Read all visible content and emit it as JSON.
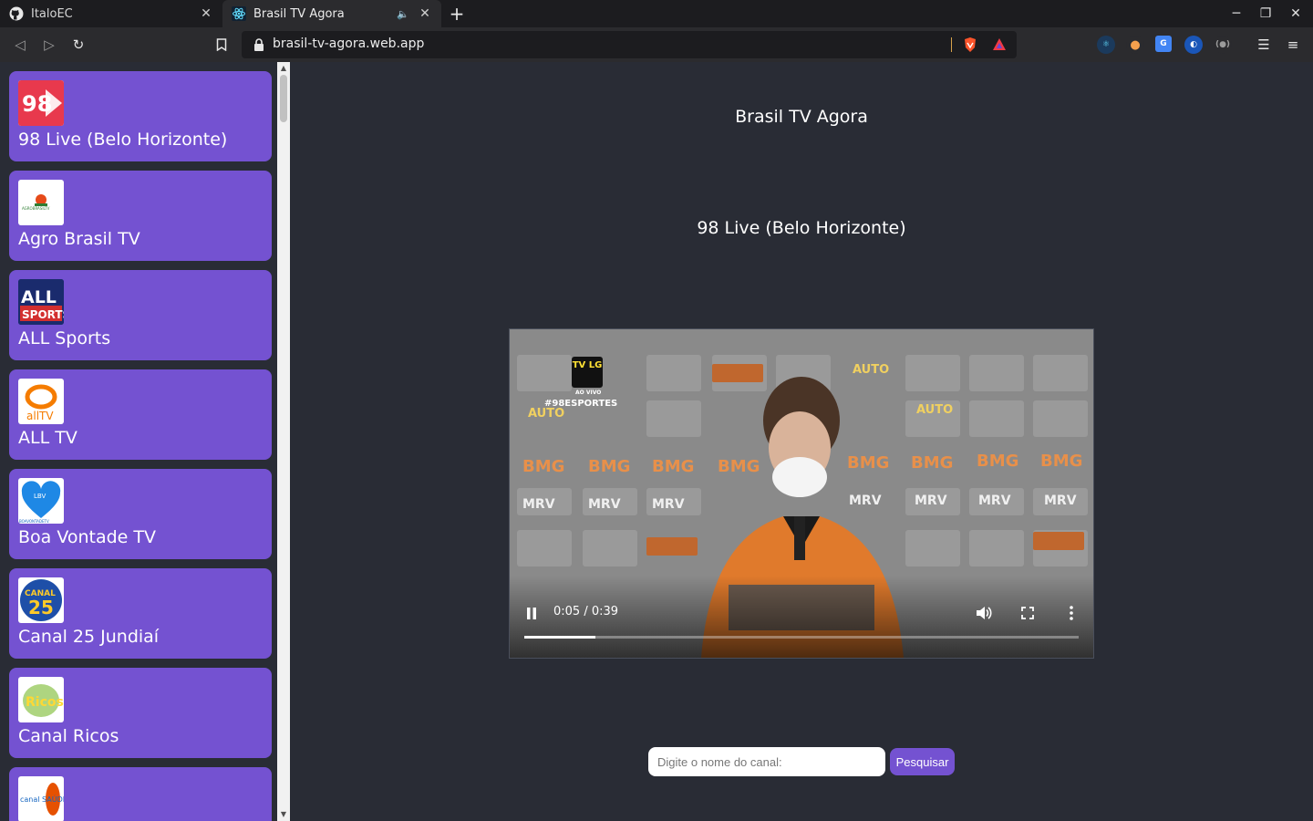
{
  "browser": {
    "tabs": [
      {
        "title": "ItaloEC",
        "active": false
      },
      {
        "title": "Brasil TV Agora",
        "active": true
      }
    ],
    "url": "brasil-tv-agora.web.app"
  },
  "app": {
    "title": "Brasil TV Agora",
    "current_channel": "98 Live (Belo Horizonte)"
  },
  "channels": [
    {
      "name": "98 Live (Belo Horizonte)",
      "logo_text": "98"
    },
    {
      "name": "Agro Brasil TV",
      "logo_text": "AGROBRASILTV"
    },
    {
      "name": "ALL Sports",
      "logo_text": "ALL SPORTS"
    },
    {
      "name": "ALL TV",
      "logo_text": "allTV"
    },
    {
      "name": "Boa Vontade TV",
      "logo_text": "BOAVONTADETV"
    },
    {
      "name": "Canal 25 Jundiaí",
      "logo_text": "CANAL 25"
    },
    {
      "name": "Canal Ricos",
      "logo_text": "Ricos"
    },
    {
      "name": "",
      "logo_text": "canal SAÚDE"
    }
  ],
  "player": {
    "time": "0:05 / 0:39",
    "progress": 0.128,
    "overlay_tag": "#98ESPORTES",
    "live_badge": "TV LG",
    "live_sub": "AO VIVO"
  },
  "search": {
    "placeholder": "Digite o nome do canal:",
    "button_label": "Pesquisar"
  },
  "colors": {
    "accent": "#7452d1",
    "page_bg": "#292c35"
  }
}
